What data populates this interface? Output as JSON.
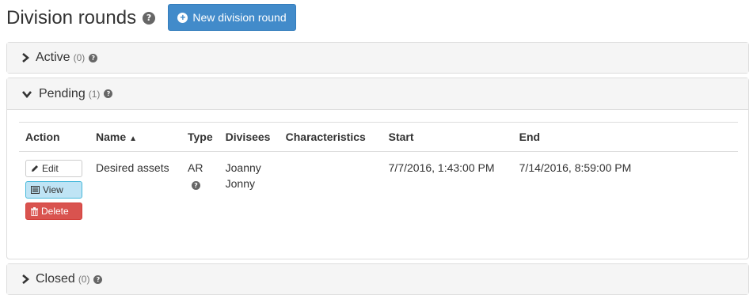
{
  "header": {
    "title": "Division rounds",
    "new_button_label": "New division round",
    "help_glyph": "?"
  },
  "panels": {
    "active": {
      "label": "Active",
      "count": "(0)"
    },
    "pending": {
      "label": "Pending",
      "count": "(1)"
    },
    "closed": {
      "label": "Closed",
      "count": "(0)"
    }
  },
  "table": {
    "columns": {
      "action": "Action",
      "name": "Name",
      "type": "Type",
      "divisees": "Divisees",
      "characteristics": "Characteristics",
      "start": "Start",
      "end": "End"
    },
    "rows": [
      {
        "actions": {
          "edit": "Edit",
          "view": "View",
          "delete": "Delete"
        },
        "name": "Desired assets",
        "type": "AR",
        "divisees": [
          "Joanny",
          "Jonny"
        ],
        "characteristics": "",
        "start": "7/7/2016, 1:43:00 PM",
        "end": "7/14/2016, 8:59:00 PM"
      }
    ]
  },
  "icons": {
    "help": "question-circle-icon",
    "new": "plus-circle-icon",
    "collapsed": "chevron-right-icon",
    "expanded": "chevron-down-icon",
    "sort": "sort-asc-icon",
    "edit": "pencil-icon",
    "view": "list-icon",
    "delete": "trash-icon"
  },
  "colors": {
    "primary": "#428bca",
    "info": "#bfe4f5",
    "danger": "#d9534f",
    "panel_heading": "#f5f5f5"
  }
}
